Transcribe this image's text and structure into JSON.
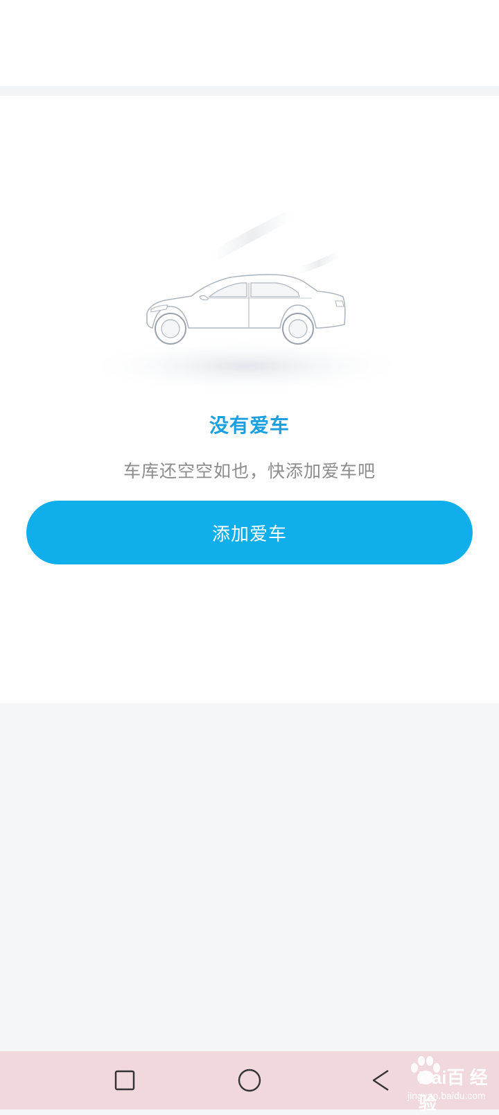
{
  "empty_state": {
    "title": "没有爱车",
    "subtitle": "车库还空空如也，快添加爱车吧",
    "illustration_icon": "sedan-car-icon"
  },
  "actions": {
    "add_car_label": "添加爱车"
  },
  "nav_bar": {
    "recent_icon": "square-icon",
    "home_icon": "circle-icon",
    "back_icon": "triangle-back-icon"
  },
  "watermark": {
    "brand": "Bai百 经验",
    "url": "jingyan.baidu.com"
  },
  "colors": {
    "accent": "#10aeea",
    "title": "#1a9fe0",
    "subtitle": "#8c8c8c",
    "nav_bar_bg": "#f0d8dc"
  }
}
